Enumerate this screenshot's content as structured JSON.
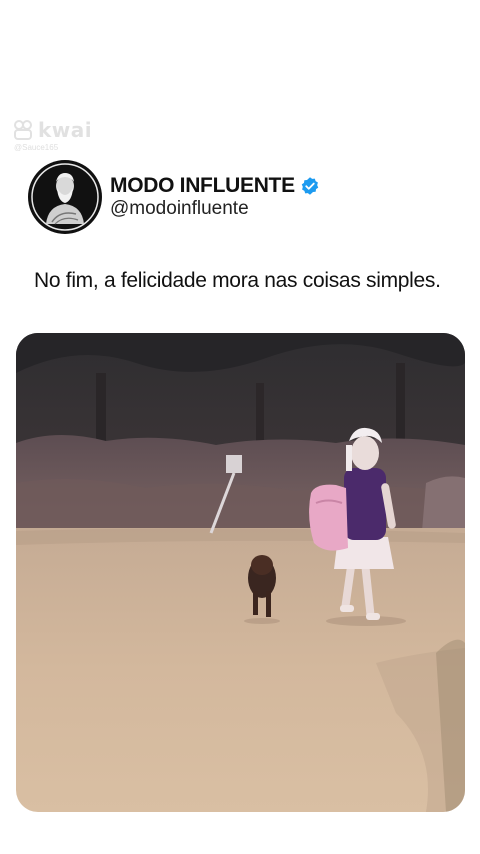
{
  "watermark": {
    "brand": "kwai",
    "user": "@Sauce165"
  },
  "profile": {
    "display_name": "MODO INFLUENTE",
    "handle": "@modoinfluente",
    "verified": true
  },
  "post": {
    "text": "No fim, a felicidade mora nas coisas simples."
  },
  "media": {
    "description_icon": "video-still"
  },
  "colors": {
    "verified": "#1d9bf0",
    "avatar_bg": "#111111",
    "text": "#111111"
  }
}
